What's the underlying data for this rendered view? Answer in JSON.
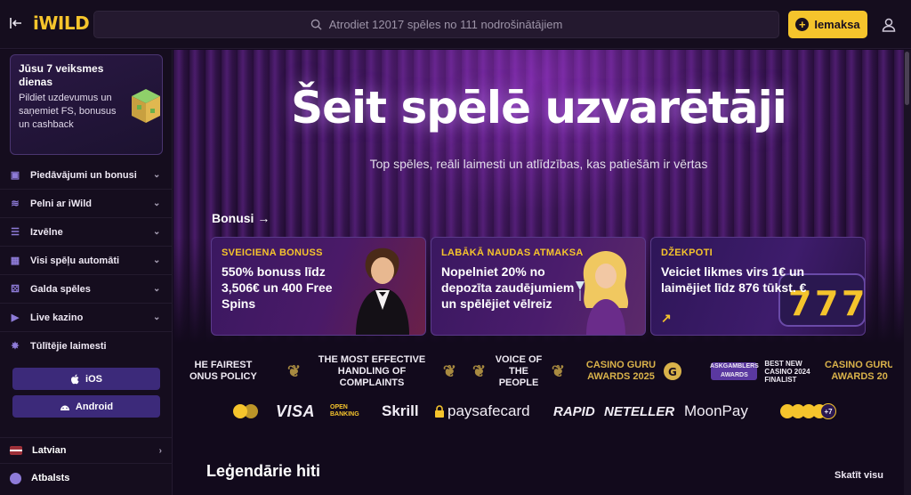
{
  "header": {
    "logo_i": "i",
    "logo_wild": "WILD",
    "search_placeholder": "Atrodiet 12017 spēles no 111 nodrošinātājiem",
    "deposit_label": "Iemaksa"
  },
  "sidebar": {
    "mission_title": "Jūsu 7 veiksmes dienas",
    "mission_text": "Pildiet uzdevumus un saņemiet FS, bonusus un cashback",
    "items": [
      {
        "label": "Piedāvājumi un bonusi",
        "icon": "gift-icon"
      },
      {
        "label": "Pelni ar iWild",
        "icon": "coins-icon"
      },
      {
        "label": "Izvēlne",
        "icon": "menu-search-icon"
      },
      {
        "label": "Visi spēļu automāti",
        "icon": "grid-icon"
      },
      {
        "label": "Galda spēles",
        "icon": "dice-icon"
      },
      {
        "label": "Live kazino",
        "icon": "play-icon"
      },
      {
        "label": "Tūlītējie laimesti",
        "icon": "burst-icon"
      }
    ],
    "ios_label": "iOS",
    "android_label": "Android",
    "language": "Latvian",
    "support": "Atbalsts"
  },
  "hero": {
    "title": "Šeit spēlē uzvarētāji",
    "subtitle": "Top spēles, reāli laimesti un atlīdzības, kas patiešām ir vērtas"
  },
  "bonuses": {
    "heading": "Bonusi",
    "arrow": "→",
    "cards": [
      {
        "kicker": "SVEICIENA BONUSS",
        "text": "550% bonuss līdz 3,506€ un 400 Free Spins"
      },
      {
        "kicker": "LABĀKĀ NAUDAS ATMAKSA",
        "text": "Nopelniet 20% no depozīta zaudējumiem un spēlējiet vēlreiz"
      },
      {
        "kicker": "DŽEKPOTI",
        "text": "Veiciet likmes virs 1€ un laimējiet līdz 876 tūkst. €",
        "arrow": "↗"
      }
    ]
  },
  "awards": [
    {
      "line1": "HE FAIREST",
      "line2": "ONUS POLICY"
    },
    {
      "line1": "THE MOST EFFECTIVE",
      "line2": "HANDLING OF COMPLAINTS"
    },
    {
      "line1": "VOICE OF",
      "line2": "THE PEOPLE"
    },
    {
      "line1": "CASINO GURU",
      "line2": "AWARDS 2025"
    },
    {
      "badge": "ASKGAMBLERS AWARDS",
      "line1": "BEST NEW",
      "line2": "CASINO 2024",
      "line3": "FINALIST"
    },
    {
      "line1": "CASINO GURU",
      "line2": "AWARDS 20"
    }
  ],
  "payments": [
    "VISA",
    "OPEN BANKING",
    "Skrill",
    "paysafecard",
    "RAPID",
    "NETELLER",
    "MoonPay",
    "+7"
  ],
  "sections": {
    "legendary_title": "Leģendārie hiti",
    "see_all": "Skatīt visu"
  }
}
